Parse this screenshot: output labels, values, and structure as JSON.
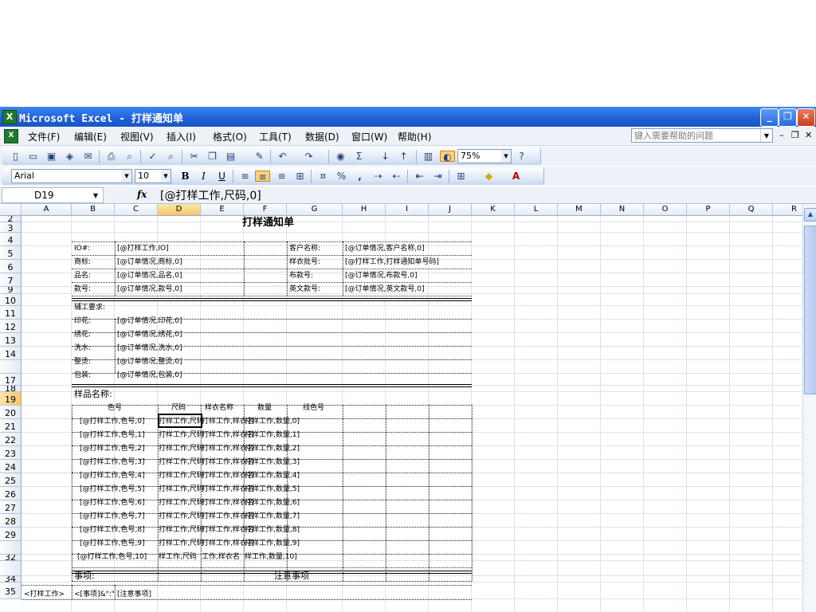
{
  "window": {
    "title": "Microsoft Excel - 打样通知单",
    "app_icon": "excel-icon",
    "controls": {
      "minimize": "_",
      "maximize": "❐",
      "close": "✕"
    }
  },
  "menu": {
    "items": [
      "文件(F)",
      "编辑(E)",
      "视图(V)",
      "插入(I)",
      "格式(O)",
      "工具(T)",
      "数据(D)",
      "窗口(W)",
      "帮助(H)"
    ],
    "help_placeholder": "键入需要帮助的问题",
    "doc_controls": {
      "minimize": "–",
      "restore": "❐",
      "close": "✕"
    }
  },
  "toolbar_standard": {
    "icons": [
      "new-icon",
      "open-icon",
      "save-icon",
      "permission-icon",
      "email-icon",
      "print-icon",
      "print-preview-icon",
      "spelling-icon",
      "research-icon",
      "cut-icon",
      "copy-icon",
      "paste-icon",
      "format-painter-icon",
      "undo-icon",
      "redo-icon",
      "hyperlink-icon",
      "autosum-icon",
      "sort-ascending-icon",
      "sort-descending-icon",
      "chart-wizard-icon",
      "drawing-icon",
      "help-icon"
    ],
    "zoom": "75%"
  },
  "toolbar_format": {
    "font": "Arial",
    "size": "10",
    "bold": "B",
    "italic": "I",
    "underline": "U",
    "percent": "%",
    "comma": ","
  },
  "formula_bar": {
    "name_box": "D19",
    "fx": "fx",
    "value": "[@打样工作,尺码,0]"
  },
  "sheet": {
    "columns": [
      "A",
      "B",
      "C",
      "D",
      "E",
      "F",
      "G",
      "H",
      "I",
      "J",
      "K",
      "L",
      "M",
      "N",
      "O",
      "P",
      "Q",
      "R"
    ],
    "selected_column": "D",
    "rows": [
      "2",
      "3",
      "4",
      "5",
      "6",
      "7",
      "9",
      "10",
      "11",
      "12",
      "13",
      "14",
      "",
      "17",
      "18",
      "19",
      "20",
      "21",
      "22",
      "23",
      "24",
      "25",
      "26",
      "27",
      "28",
      "29",
      "",
      "32",
      "",
      "34",
      "35"
    ],
    "selected_row": "19",
    "title": "打样通知单",
    "info": [
      {
        "label": "IO#:",
        "value": "[@打样工作,IO]",
        "label2": "客户名称:",
        "value2": "[@订单情况,客户名称,0]"
      },
      {
        "label": "商标:",
        "value": "[@订单情况,商标,0]",
        "label2": "样衣批号:",
        "value2": "[@打样工作,打样通知单号码]"
      },
      {
        "label": "品名:",
        "value": "[@订单情况,品名,0]",
        "label2": "布款号:",
        "value2": "[@订单情况,布款号,0]"
      },
      {
        "label": "款号:",
        "value": "[@订单情况,款号,0]",
        "label2": "英文款号:",
        "value2": "[@订单情况,英文款号,0]"
      }
    ],
    "process_header": "辅工要求:",
    "process": [
      {
        "label": "印花:",
        "value": "[@订单情况,印花,0]"
      },
      {
        "label": "绣花:",
        "value": "[@订单情况,绣花,0]"
      },
      {
        "label": "洗水:",
        "value": "[@订单情况,洗水,0]"
      },
      {
        "label": "整烫:",
        "value": "[@订单情况,整烫,0]"
      },
      {
        "label": "包装:",
        "value": "[@订单情况,包装,0]"
      }
    ],
    "sample_header": "样品名称:",
    "sample_columns": [
      "色号",
      "尺码",
      "样衣名称",
      "数量",
      "线色号"
    ],
    "samples": [
      {
        "color": "[@打样工作,色号,0]",
        "size": "打样工作,尺码",
        "name": "打样工作,样衣名",
        "qty": "打样工作,数量,0]"
      },
      {
        "color": "[@打样工作,色号,1]",
        "size": "打样工作,尺码",
        "name": "打样工作,样衣名",
        "qty": "打样工作,数量,1]"
      },
      {
        "color": "[@打样工作,色号,2]",
        "size": "打样工作,尺码",
        "name": "打样工作,样衣名",
        "qty": "打样工作,数量,2]"
      },
      {
        "color": "[@打样工作,色号,3]",
        "size": "打样工作,尺码",
        "name": "打样工作,样衣名",
        "qty": "打样工作,数量,3]"
      },
      {
        "color": "[@打样工作,色号,4]",
        "size": "打样工作,尺码",
        "name": "打样工作,样衣名",
        "qty": "打样工作,数量,4]"
      },
      {
        "color": "[@打样工作,色号,5]",
        "size": "打样工作,尺码",
        "name": "打样工作,样衣名",
        "qty": "打样工作,数量,5]"
      },
      {
        "color": "[@打样工作,色号,6]",
        "size": "打样工作,尺码",
        "name": "打样工作,样衣名",
        "qty": "打样工作,数量,6]"
      },
      {
        "color": "[@打样工作,色号,7]",
        "size": "打样工作,尺码",
        "name": "打样工作,样衣名",
        "qty": "打样工作,数量,7]"
      },
      {
        "color": "[@打样工作,色号,8]",
        "size": "打样工作,尺码",
        "name": "打样工作,样衣名",
        "qty": "打样工作,数量,8]"
      },
      {
        "color": "[@打样工作,色号,9]",
        "size": "打样工作,尺码",
        "name": "打样工作,样衣名",
        "qty": "打样工作,数量,9]"
      },
      {
        "color": "[@打样工作,色号,10]",
        "size": "样工作,尺码",
        "name": "工作,样衣名",
        "qty": "样工作,数量,10]"
      }
    ],
    "notes_label": "事项:",
    "notes_title": "注意事项",
    "row34": {
      "a": "<打样工作>",
      "b": "<[事项]&\":\"",
      "c": "[注意事项]"
    }
  },
  "colors": {
    "titlebar": "#1f5fd8",
    "selection_header": "#f8c56a",
    "grid": "#dbe2ee"
  }
}
